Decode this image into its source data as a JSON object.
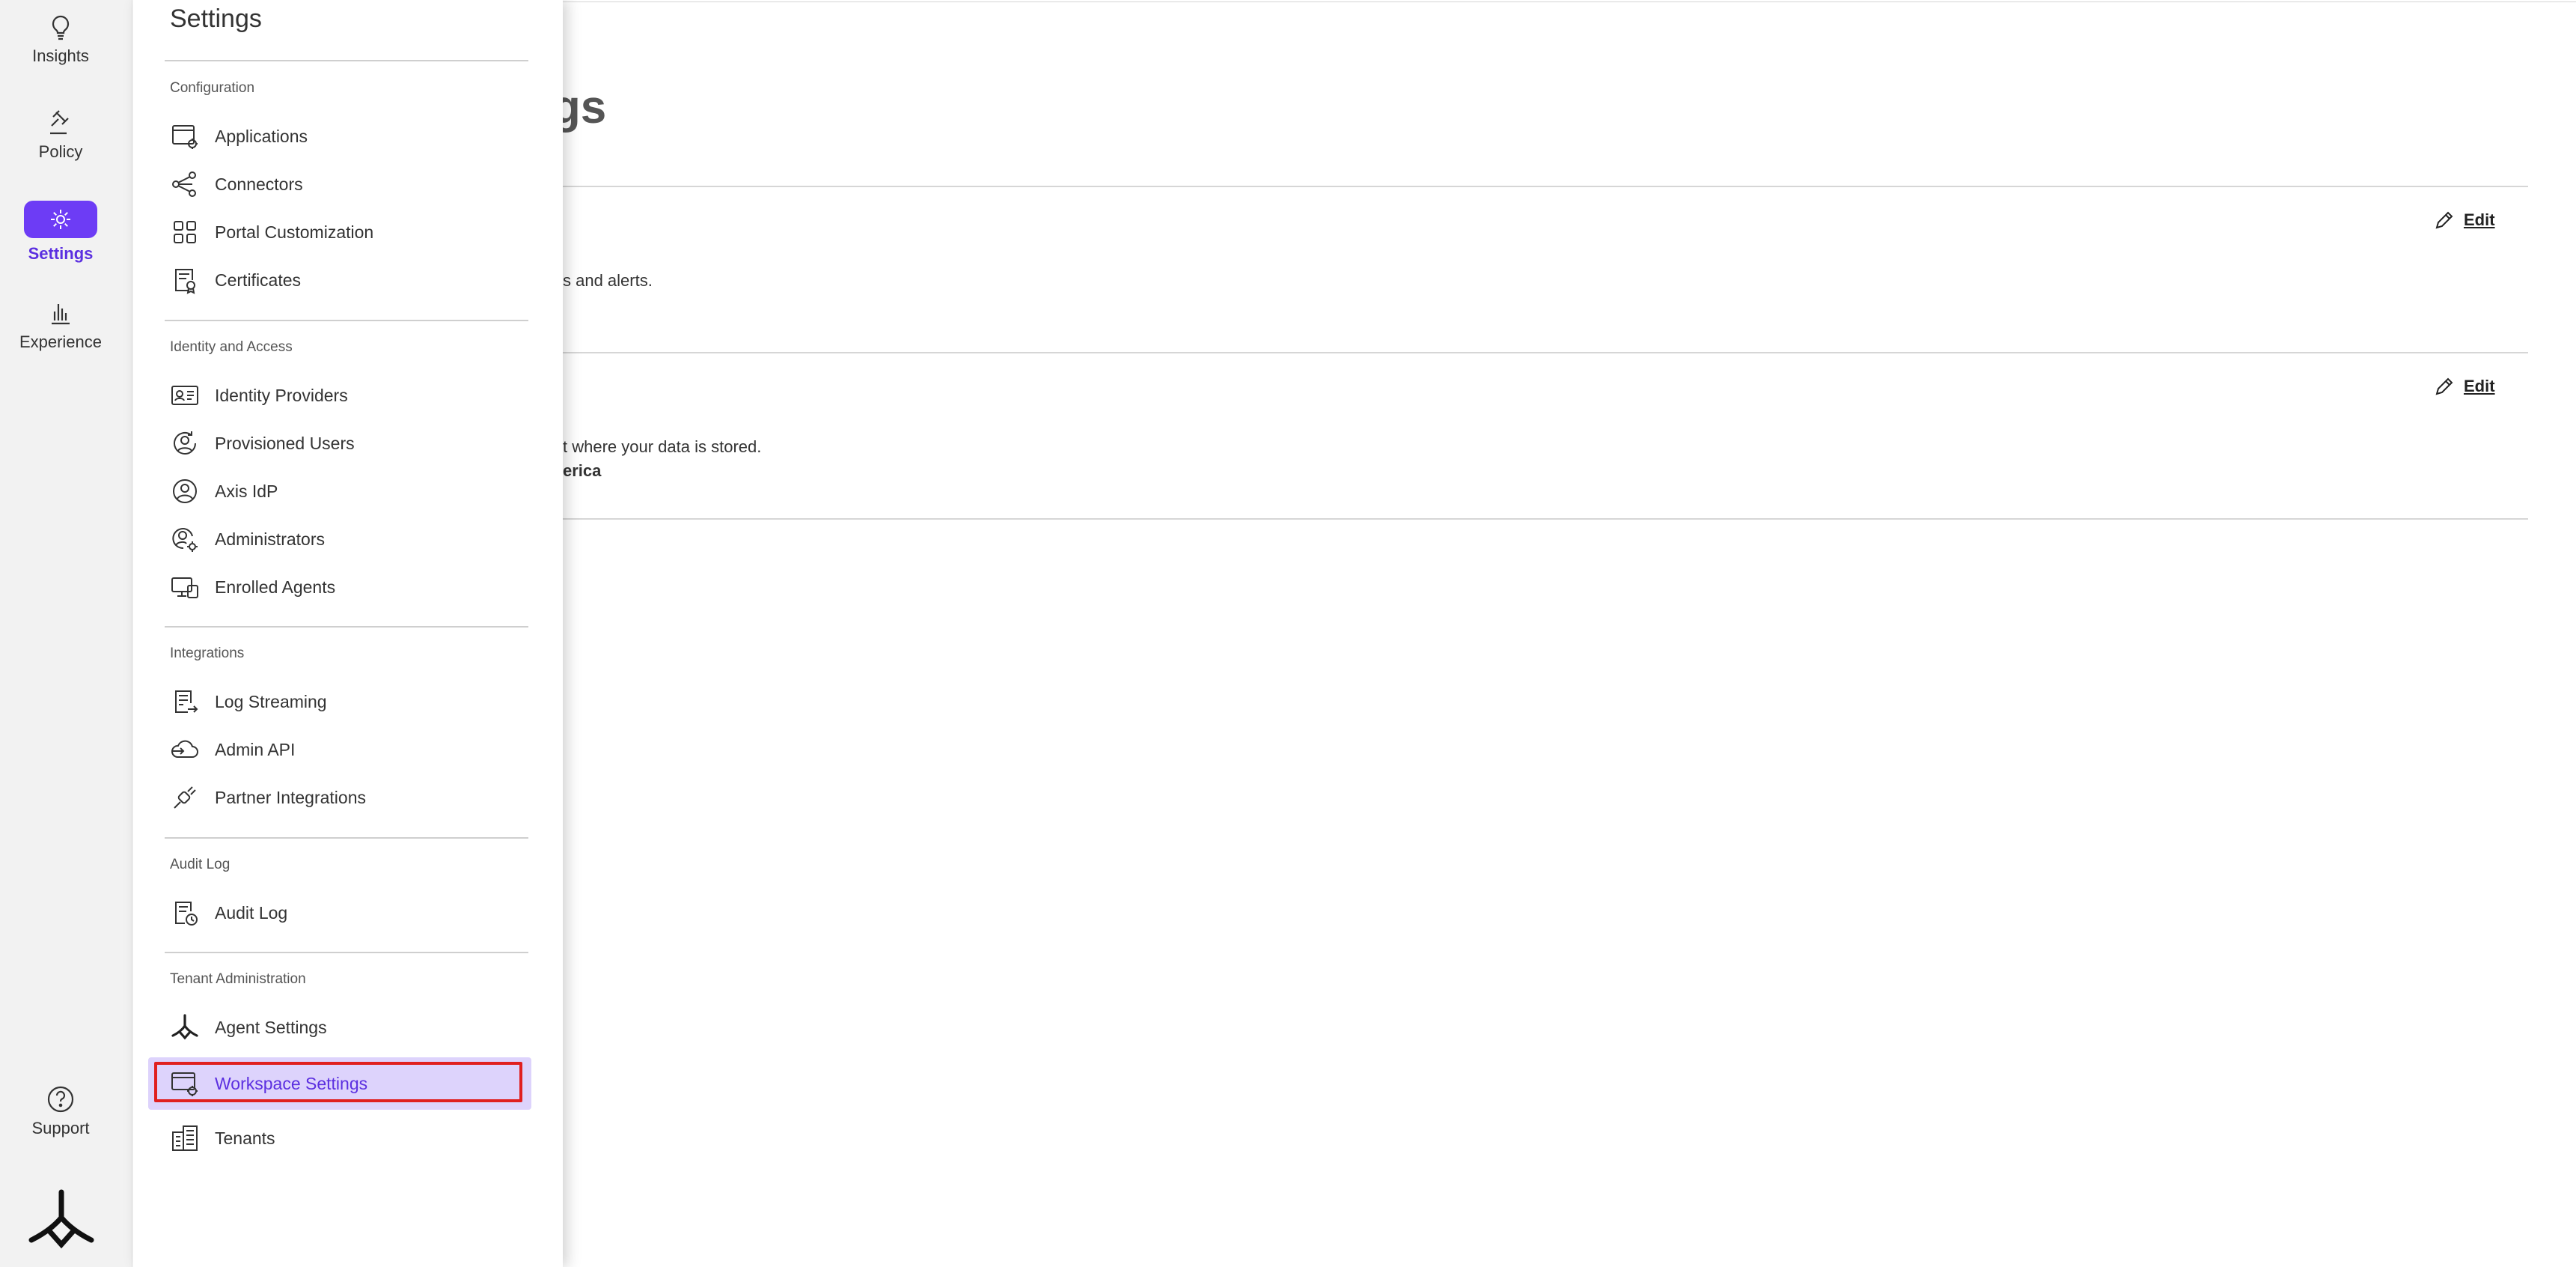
{
  "rail": {
    "items": [
      {
        "label": "Insights",
        "icon": "lightbulb-icon"
      },
      {
        "label": "Policy",
        "icon": "gavel-icon"
      },
      {
        "label": "Settings",
        "icon": "gear-icon",
        "active": true
      },
      {
        "label": "Experience",
        "icon": "bar-chart-icon"
      }
    ],
    "support_label": "Support",
    "logo": "brand-logo"
  },
  "background": {
    "title_fragment": "ngs",
    "row1_text_fragment": "s and alerts.",
    "row2_text_fragment": "t where your data is stored.",
    "row2_value_fragment": "erica",
    "edit_label": "Edit"
  },
  "panel": {
    "title": "Settings",
    "sections": [
      {
        "label": "Configuration",
        "items": [
          {
            "label": "Applications",
            "icon": "applications-icon"
          },
          {
            "label": "Connectors",
            "icon": "connectors-icon"
          },
          {
            "label": "Portal Customization",
            "icon": "grid-icon"
          },
          {
            "label": "Certificates",
            "icon": "certificate-icon"
          }
        ]
      },
      {
        "label": "Identity and Access",
        "items": [
          {
            "label": "Identity Providers",
            "icon": "id-card-icon"
          },
          {
            "label": "Provisioned Users",
            "icon": "user-sync-icon"
          },
          {
            "label": "Axis IdP",
            "icon": "user-circle-icon"
          },
          {
            "label": "Administrators",
            "icon": "admin-gear-icon"
          },
          {
            "label": "Enrolled Agents",
            "icon": "devices-icon"
          }
        ]
      },
      {
        "label": "Integrations",
        "items": [
          {
            "label": "Log Streaming",
            "icon": "log-stream-icon"
          },
          {
            "label": "Admin API",
            "icon": "cloud-api-icon"
          },
          {
            "label": "Partner Integrations",
            "icon": "plug-icon"
          }
        ]
      },
      {
        "label": "Audit Log",
        "items": [
          {
            "label": "Audit Log",
            "icon": "audit-clock-icon"
          }
        ]
      },
      {
        "label": "Tenant Administration",
        "items": [
          {
            "label": "Agent Settings",
            "icon": "agent-logo-icon"
          },
          {
            "label": "Workspace Settings",
            "icon": "workspace-gear-icon",
            "selected": true
          },
          {
            "label": "Tenants",
            "icon": "buildings-icon"
          }
        ]
      }
    ]
  },
  "colors": {
    "accent": "#6d3cf5",
    "selected_bg": "#ddd3fc",
    "highlight_border": "#e02020"
  }
}
